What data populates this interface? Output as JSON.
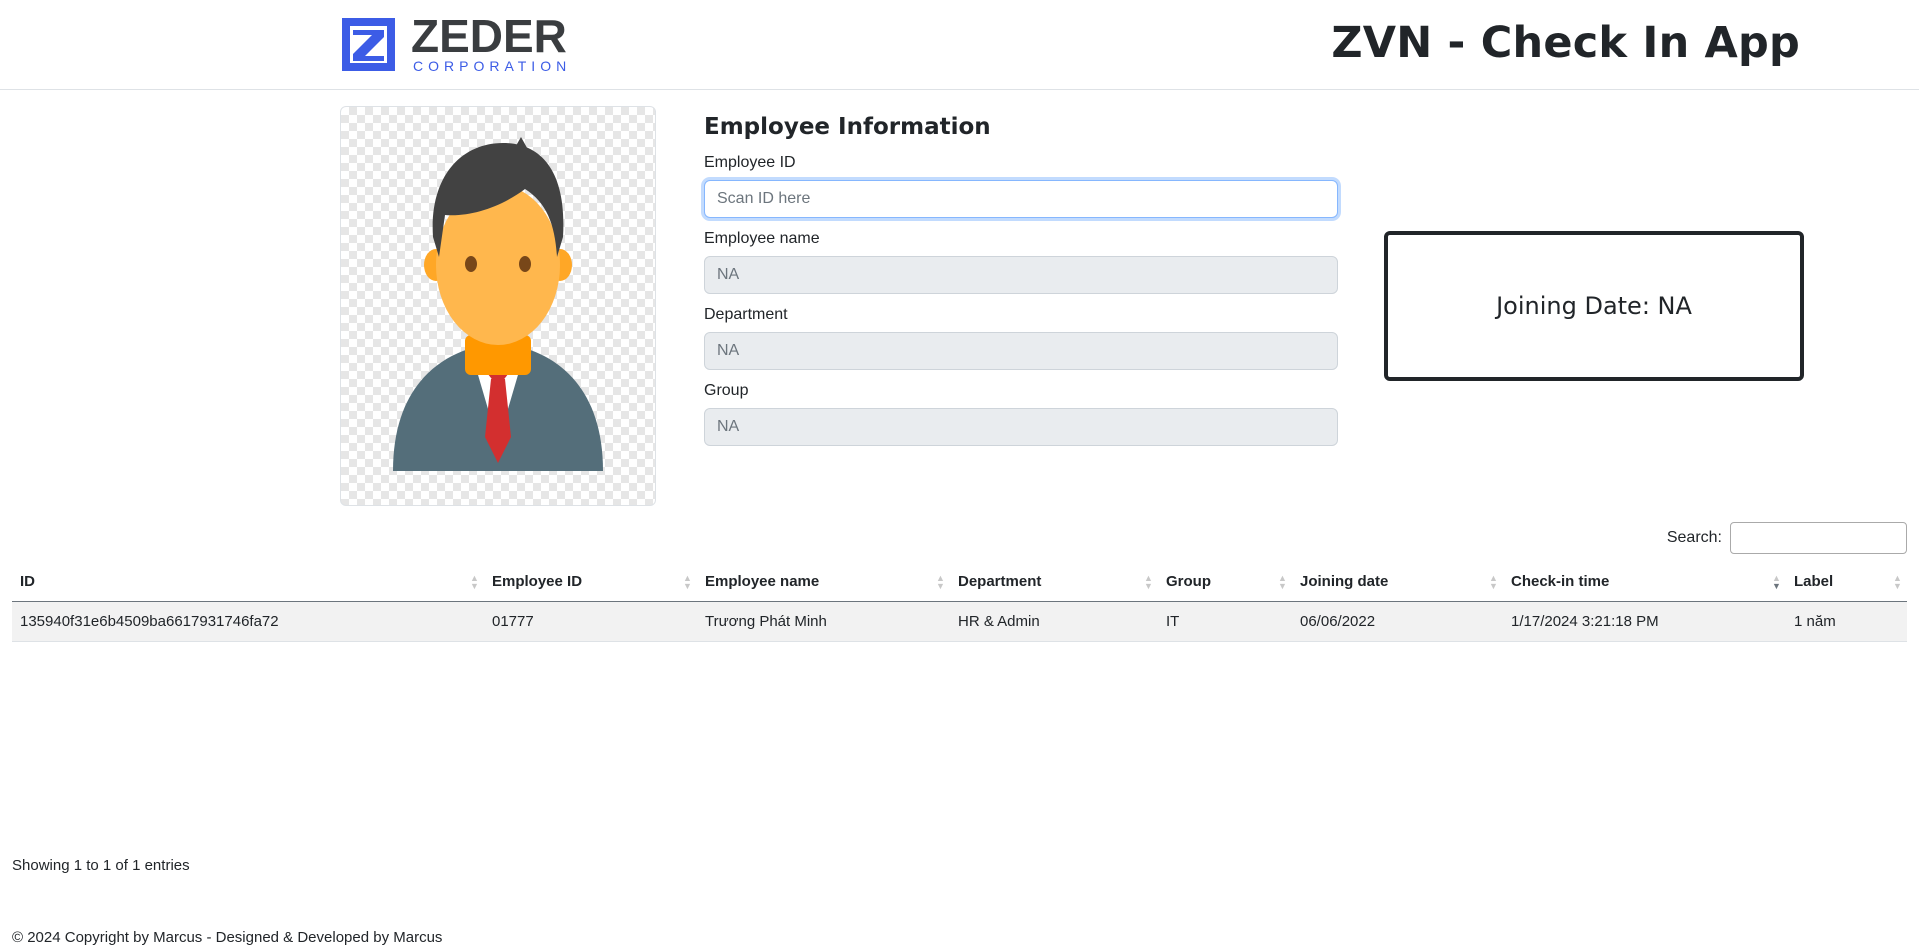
{
  "header": {
    "brand_name": "ZEDER",
    "brand_sub": "CORPORATION",
    "app_title": "ZVN - Check In App"
  },
  "avatar": {
    "alt": "employee-avatar"
  },
  "form": {
    "title": "Employee Information",
    "employee_id": {
      "label": "Employee ID",
      "value": "",
      "placeholder": "Scan ID here"
    },
    "employee_name": {
      "label": "Employee name",
      "value": "NA"
    },
    "department": {
      "label": "Department",
      "value": "NA"
    },
    "group": {
      "label": "Group",
      "value": "NA"
    }
  },
  "joining_box": {
    "text": "Joining Date: NA"
  },
  "search": {
    "label": "Search:",
    "value": ""
  },
  "table": {
    "columns": [
      "ID",
      "Employee ID",
      "Employee name",
      "Department",
      "Group",
      "Joining date",
      "Check-in time",
      "Label"
    ],
    "sorted_column": "Check-in time",
    "sort_direction": "descending",
    "rows": [
      [
        "135940f31e6b4509ba6617931746fa72",
        "01777",
        "Trương Phát Minh",
        "HR & Admin",
        "IT",
        "06/06/2022",
        "1/17/2024 3:21:18 PM",
        "1 năm"
      ]
    ]
  },
  "info": "Showing 1 to 1 of 1 entries",
  "footer": "© 2024 Copyright by Marcus - Designed & Developed by Marcus",
  "colors": {
    "brand_blue": "#3c5ce6",
    "brand_dark": "#3a3d40",
    "focus": "#86b7fe",
    "border_dark": "#212529"
  }
}
